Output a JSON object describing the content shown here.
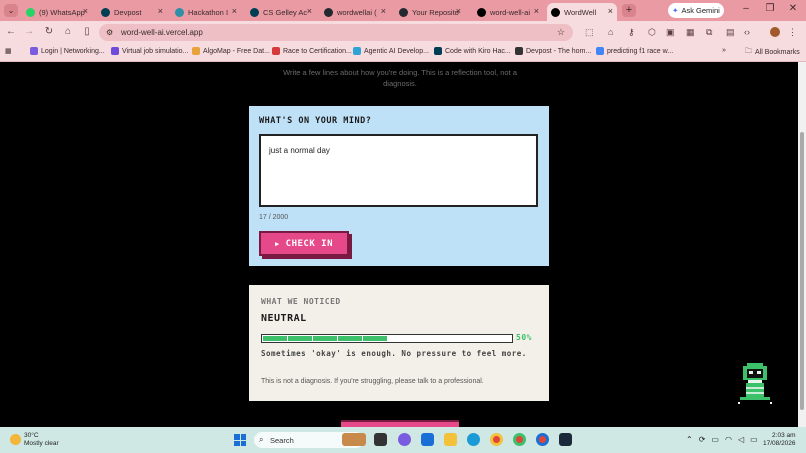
{
  "browser": {
    "tabs": [
      {
        "title": "(9) WhatsApp",
        "icon": "whatsapp-icon",
        "color": "#25d366"
      },
      {
        "title": "Devpost",
        "icon": "devpost-icon",
        "color": "#003e54"
      },
      {
        "title": "Hackathon I",
        "icon": "hackathon-icon",
        "color": "#2f8fa8"
      },
      {
        "title": "CS Gelley Ac",
        "icon": "devpost-icon",
        "color": "#003e54"
      },
      {
        "title": "wordwellai (",
        "icon": "github-icon",
        "color": "#24292f"
      },
      {
        "title": "Your Reposito",
        "icon": "github-icon",
        "color": "#24292f"
      },
      {
        "title": "word-well-ai",
        "icon": "vercel-icon",
        "color": "#000000"
      },
      {
        "title": "WordWell",
        "icon": "vercel-icon",
        "color": "#000000"
      }
    ],
    "ask_gemini": "Ask Gemini",
    "url": "word-well-ai.vercel.app",
    "bookmarks": [
      {
        "label": "Login | Networking...",
        "color": "#7a5ce0"
      },
      {
        "label": "Virtual job simulatio...",
        "color": "#6c4cd8"
      },
      {
        "label": "AlgoMap - Free Dat...",
        "color": "#e8a23a"
      },
      {
        "label": "Race to Certification...",
        "color": "#d63a3a"
      },
      {
        "label": "Agentic AI Develop...",
        "color": "#2fa3d6"
      },
      {
        "label": "Code with Kiro Hac...",
        "color": "#003e54"
      },
      {
        "label": "Devpost - The hom...",
        "color": "#333333"
      },
      {
        "label": "predicting f1 race w...",
        "color": "#4285f4"
      }
    ],
    "all_bookmarks": "All Bookmarks"
  },
  "app": {
    "intro_line1": "Write a few lines about how you're doing. This is a reflection tool, not a",
    "intro_line2": "diagnosis.",
    "checkin": {
      "heading": "WHAT'S ON YOUR MIND?",
      "text_value": "just a normal day",
      "char_count": "17 / 2000",
      "button_label": "CHECK IN",
      "accent": "#e6498a",
      "card_bg": "#bfe1f7"
    },
    "noticed": {
      "label": "WHAT WE NOTICED",
      "mood": "NEUTRAL",
      "percent_value": 0.5,
      "percent_label": "50%",
      "message": "Sometimes 'okay' is enough. No pressure to feel more.",
      "disclaimer": "This is not a diagnosis. If you're struggling, please talk to a professional.",
      "bar_color": "#3cc06a"
    }
  },
  "taskbar": {
    "temp": "30°C",
    "condition": "Mostly clear",
    "search_placeholder": "Search",
    "time": "2:03 am",
    "date": "17/08/2026"
  }
}
